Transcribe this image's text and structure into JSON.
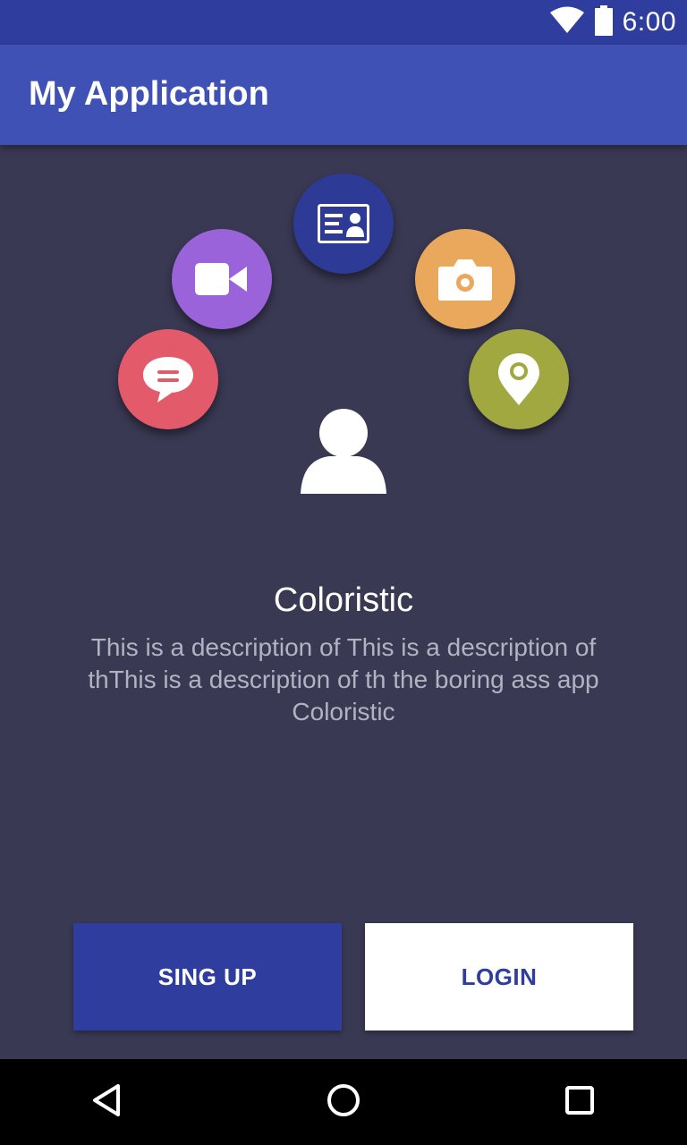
{
  "status_bar": {
    "time": "6:00",
    "icons": [
      "wifi-icon",
      "battery-icon"
    ]
  },
  "app_bar": {
    "title": "My Application"
  },
  "menu_icons": [
    {
      "name": "chat-icon",
      "color": "#e35a6a"
    },
    {
      "name": "video-camera-icon",
      "color": "#9b63d9"
    },
    {
      "name": "id-card-icon",
      "color": "#2d3a96"
    },
    {
      "name": "camera-icon",
      "color": "#eaa85c"
    },
    {
      "name": "location-pin-icon",
      "color": "#a2a840"
    }
  ],
  "center_icon": "person-icon",
  "main": {
    "title": "Coloristic",
    "description": "This is a description of This is a description of thThis is a description of th the boring ass app Coloristic"
  },
  "buttons": {
    "signup_label": "SING UP",
    "login_label": "LOGIN"
  },
  "nav_bar": {
    "icons": [
      "back-icon",
      "home-icon",
      "recents-icon"
    ]
  },
  "colors": {
    "status_bar": "#2f3e9e",
    "app_bar": "#3f51b5",
    "background": "#3a3954",
    "signup_button": "#2f3e9e",
    "login_button": "#ffffff"
  }
}
